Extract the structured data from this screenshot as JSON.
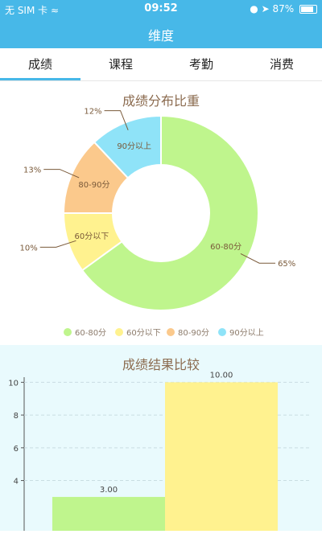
{
  "status": {
    "carrier": "无 SIM 卡",
    "time": "09:52",
    "battery": "87%",
    "battery_level": 0.87
  },
  "nav": {
    "title": "维度"
  },
  "tabs": [
    {
      "label": "成绩",
      "active": true
    },
    {
      "label": "课程",
      "active": false
    },
    {
      "label": "考勤",
      "active": false
    },
    {
      "label": "消费",
      "active": false
    }
  ],
  "chart_data": [
    {
      "type": "pie",
      "title": "成绩分布比重",
      "donut": true,
      "slices": [
        {
          "name": "60-80分",
          "value": 65,
          "label": "65%",
          "color": "#bff58d"
        },
        {
          "name": "60分以下",
          "value": 10,
          "label": "10%",
          "color": "#fff28f"
        },
        {
          "name": "80-90分",
          "value": 13,
          "label": "13%",
          "color": "#fbc98c"
        },
        {
          "name": "90分以上",
          "value": 12,
          "label": "12%",
          "color": "#8fe3f8"
        }
      ],
      "legend_position": "bottom"
    },
    {
      "type": "bar",
      "title": "成绩结果比较",
      "categories": [
        "",
        ""
      ],
      "values": [
        3.0,
        10.0
      ],
      "value_labels": [
        "3.00",
        "10.00"
      ],
      "colors": [
        "#bff58d",
        "#fff28f"
      ],
      "yticks": [
        "4",
        "6",
        "8",
        "10"
      ],
      "ylim": [
        0,
        11
      ],
      "grid": true
    }
  ]
}
